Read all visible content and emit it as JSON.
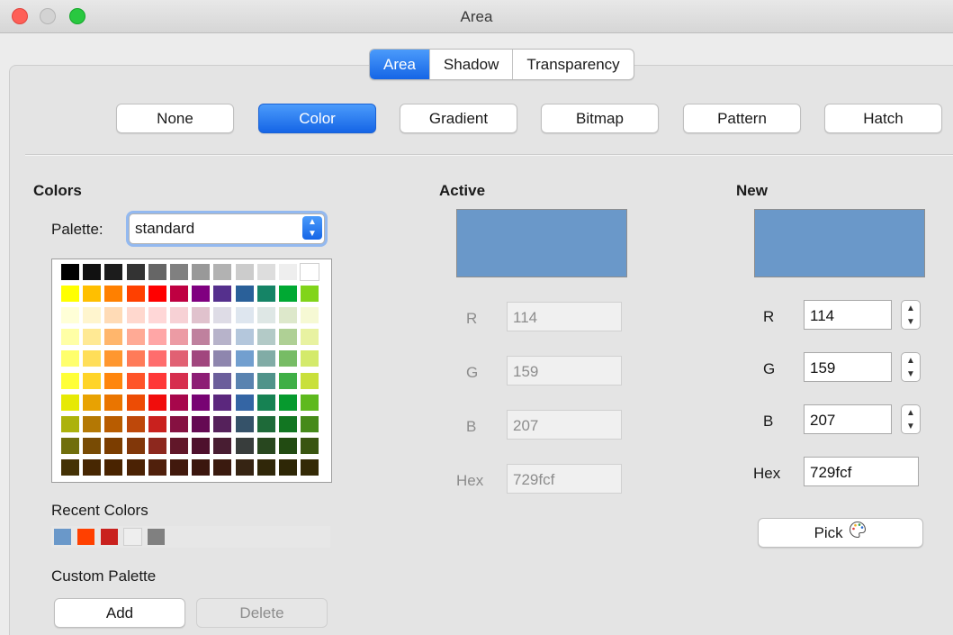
{
  "window": {
    "title": "Area"
  },
  "tabs": [
    {
      "label": "Area",
      "active": true
    },
    {
      "label": "Shadow",
      "active": false
    },
    {
      "label": "Transparency",
      "active": false
    }
  ],
  "fill_types": [
    "None",
    "Color",
    "Gradient",
    "Bitmap",
    "Pattern",
    "Hatch"
  ],
  "fill_type_selected": "Color",
  "colors": {
    "heading": "Colors",
    "palette_label": "Palette:",
    "palette_value": "standard",
    "grid_rows": [
      [
        "#000000",
        "#111111",
        "#1c1c1c",
        "#333333",
        "#666666",
        "#808080",
        "#999999",
        "#b2b2b2",
        "#cccccc",
        "#dddddd",
        "#eeeeee",
        "#ffffff"
      ],
      [
        "#ffff00",
        "#ffbf00",
        "#ff8000",
        "#ff4000",
        "#ff0000",
        "#bf0041",
        "#800080",
        "#55308d",
        "#2a6099",
        "#158466",
        "#00a933",
        "#81d41a"
      ],
      [
        "#ffffd7",
        "#fff5ce",
        "#ffdbb6",
        "#ffd8ce",
        "#ffd7d7",
        "#f7d1d5",
        "#e0c2cd",
        "#dedce6",
        "#dee6ef",
        "#dee7e5",
        "#dde8cb",
        "#f6f9d4"
      ],
      [
        "#ffffa6",
        "#ffe994",
        "#ffb66c",
        "#ffaa95",
        "#ffa6a6",
        "#ec9ba4",
        "#bf819e",
        "#b7b3ca",
        "#b4c7dc",
        "#b3cac7",
        "#afd095",
        "#e8f2a1"
      ],
      [
        "#ffff6d",
        "#ffde59",
        "#ff972f",
        "#ff7b59",
        "#ff6d6d",
        "#e16173",
        "#a1467e",
        "#8e86ae",
        "#729fcf",
        "#81aca6",
        "#77bc65",
        "#d4ea6b"
      ],
      [
        "#ffff38",
        "#ffd428",
        "#ff860d",
        "#ff5429",
        "#ff3838",
        "#d62e4e",
        "#8d1d75",
        "#6b5e9b",
        "#5983b0",
        "#50938a",
        "#3faf46",
        "#c9e03b"
      ],
      [
        "#e6e905",
        "#e8a202",
        "#ea7500",
        "#ed4c05",
        "#f10d0c",
        "#a7074b",
        "#780373",
        "#5b277d",
        "#3465a4",
        "#168253",
        "#069a2e",
        "#5eb91e"
      ],
      [
        "#acb20c",
        "#b47804",
        "#b85c00",
        "#be480a",
        "#c9211e",
        "#861141",
        "#650953",
        "#55215b",
        "#355269",
        "#1e6a39",
        "#127622",
        "#468a1a"
      ],
      [
        "#706e0c",
        "#784b04",
        "#7b3d00",
        "#813709",
        "#8d281e",
        "#611729",
        "#4e102d",
        "#481d32",
        "#383d3c",
        "#28471f",
        "#224b12",
        "#395511"
      ],
      [
        "#443205",
        "#472702",
        "#492300",
        "#4b2204",
        "#50200c",
        "#41190d",
        "#3b160e",
        "#3a1a0f",
        "#362413",
        "#302709",
        "#2e2706",
        "#342a06"
      ]
    ],
    "recent_label": "Recent Colors",
    "recent_swatches": [
      "#6a98c9",
      "#ff4000",
      "#c9211e",
      "#eeeeee",
      "#808080"
    ],
    "custom_palette_label": "Custom Palette",
    "add_label": "Add",
    "delete_label": "Delete"
  },
  "active": {
    "heading": "Active",
    "color": "#6a98c9",
    "r_label": "R",
    "r_value": "114",
    "g_label": "G",
    "g_value": "159",
    "b_label": "B",
    "b_value": "207",
    "hex_label": "Hex",
    "hex_value": "729fcf"
  },
  "new": {
    "heading": "New",
    "color": "#6a98c9",
    "r_label": "R",
    "r_value": "114",
    "g_label": "G",
    "g_value": "159",
    "b_label": "B",
    "b_value": "207",
    "hex_label": "Hex",
    "hex_value": "729fcf",
    "pick_label": "Pick"
  }
}
